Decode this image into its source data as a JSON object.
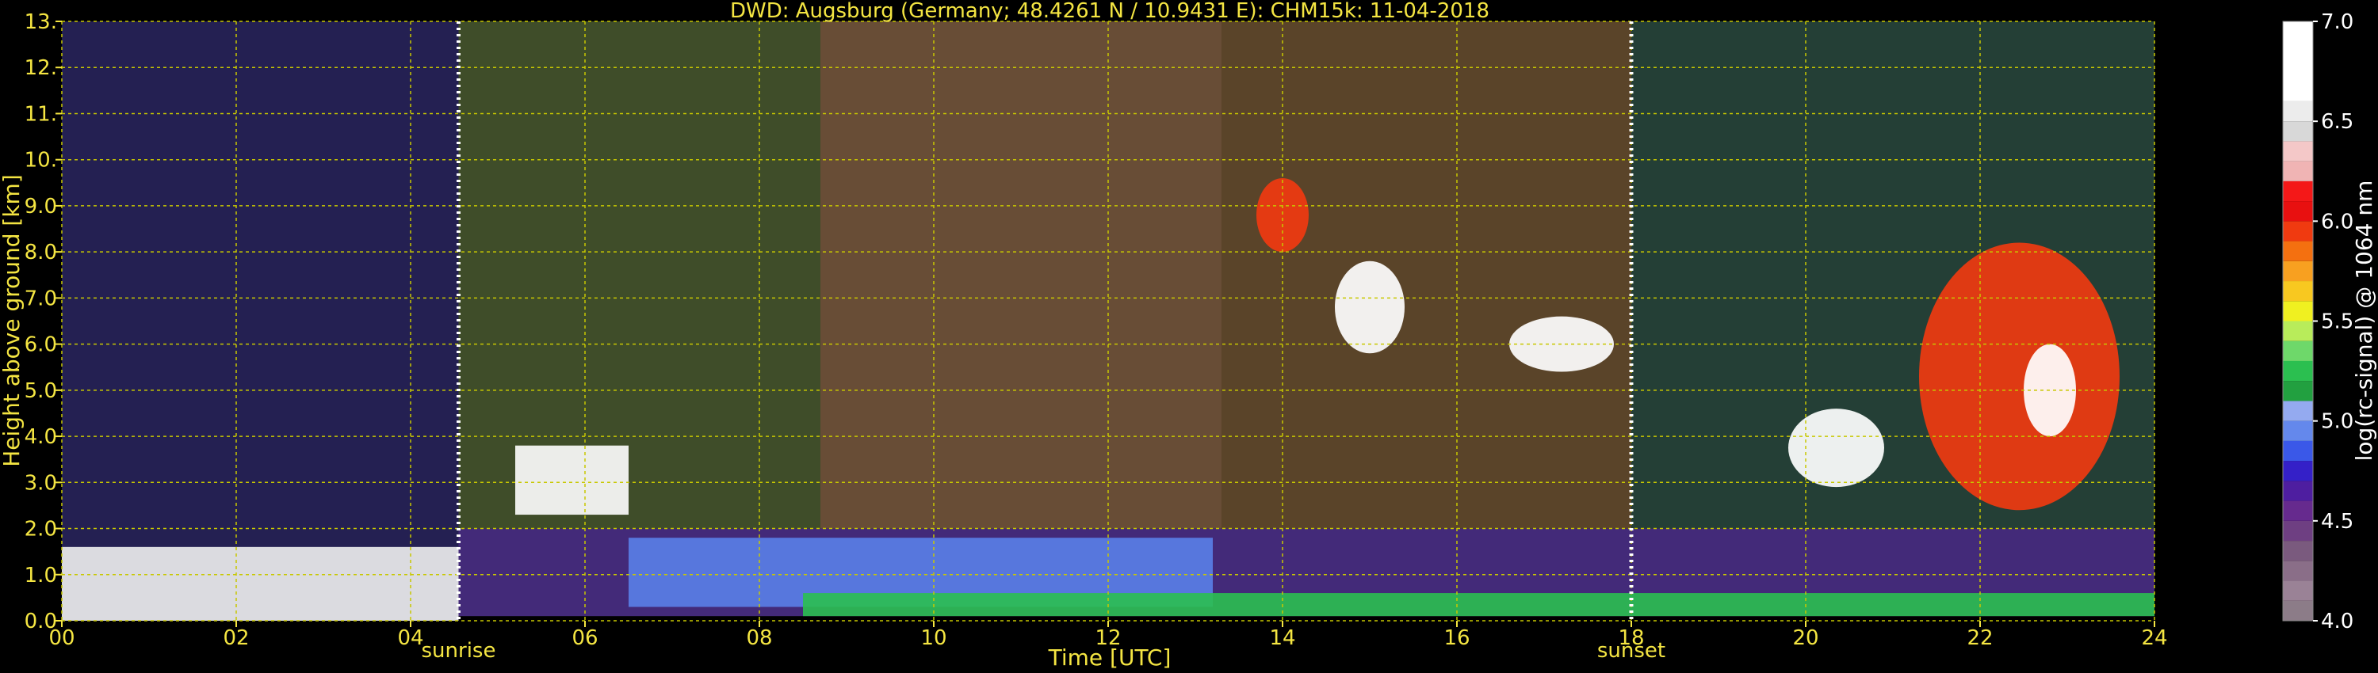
{
  "chart_data": {
    "type": "heatmap",
    "title": "DWD: Augsburg (Germany; 48.4261 N / 10.9431 E):    CHM15k: 11-04-2018",
    "xlabel": "Time [UTC]",
    "ylabel": "Height above ground [km]",
    "xlim": [
      0,
      24
    ],
    "ylim": [
      0,
      13
    ],
    "x_ticks": [
      {
        "value": 0,
        "label": "00"
      },
      {
        "value": 2,
        "label": "02"
      },
      {
        "value": 4,
        "label": "04"
      },
      {
        "value": 6,
        "label": "06"
      },
      {
        "value": 8,
        "label": "08"
      },
      {
        "value": 10,
        "label": "10"
      },
      {
        "value": 12,
        "label": "12"
      },
      {
        "value": 14,
        "label": "14"
      },
      {
        "value": 16,
        "label": "16"
      },
      {
        "value": 18,
        "label": "18"
      },
      {
        "value": 20,
        "label": "20"
      },
      {
        "value": 22,
        "label": "22"
      },
      {
        "value": 24,
        "label": "24"
      }
    ],
    "y_ticks": [
      {
        "value": 0,
        "label": "0.0"
      },
      {
        "value": 1,
        "label": "1.0"
      },
      {
        "value": 2,
        "label": "2.0"
      },
      {
        "value": 3,
        "label": "3.0"
      },
      {
        "value": 4,
        "label": "4.0"
      },
      {
        "value": 5,
        "label": "5.0"
      },
      {
        "value": 6,
        "label": "6.0"
      },
      {
        "value": 7,
        "label": "7.0"
      },
      {
        "value": 8,
        "label": "8.0"
      },
      {
        "value": 9,
        "label": "9.0"
      },
      {
        "value": 10,
        "label": "10."
      },
      {
        "value": 11,
        "label": "11."
      },
      {
        "value": 12,
        "label": "12."
      },
      {
        "value": 13,
        "label": "13."
      }
    ],
    "grid": true,
    "grid_color": "#c8c800",
    "annotations": [
      {
        "x": 4.55,
        "label": "sunrise"
      },
      {
        "x": 18.0,
        "label": "sunset"
      }
    ],
    "colorbar": {
      "label": "log(rc-signal) @ 1064 nm",
      "range": [
        4.0,
        7.0
      ],
      "ticks": [
        {
          "value": 4.0,
          "label": "4.0"
        },
        {
          "value": 4.5,
          "label": "4.5"
        },
        {
          "value": 5.0,
          "label": "5.0"
        },
        {
          "value": 5.5,
          "label": "5.5"
        },
        {
          "value": 6.0,
          "label": "6.0"
        },
        {
          "value": 6.5,
          "label": "6.5"
        },
        {
          "value": 7.0,
          "label": "7.0"
        }
      ],
      "bands": [
        {
          "from": 4.0,
          "to": 4.1,
          "color": "#8c7c88"
        },
        {
          "from": 4.1,
          "to": 4.2,
          "color": "#9a8296"
        },
        {
          "from": 4.2,
          "to": 4.3,
          "color": "#8a6e88"
        },
        {
          "from": 4.3,
          "to": 4.4,
          "color": "#7a5a7e"
        },
        {
          "from": 4.4,
          "to": 4.5,
          "color": "#6e3f82"
        },
        {
          "from": 4.5,
          "to": 4.6,
          "color": "#662a8e"
        },
        {
          "from": 4.6,
          "to": 4.7,
          "color": "#4e1ea0"
        },
        {
          "from": 4.7,
          "to": 4.8,
          "color": "#3420c8"
        },
        {
          "from": 4.8,
          "to": 4.9,
          "color": "#3a58e8"
        },
        {
          "from": 4.9,
          "to": 5.0,
          "color": "#6488ec"
        },
        {
          "from": 5.0,
          "to": 5.1,
          "color": "#94aaf0"
        },
        {
          "from": 5.1,
          "to": 5.2,
          "color": "#22a040"
        },
        {
          "from": 5.2,
          "to": 5.3,
          "color": "#2bbf50"
        },
        {
          "from": 5.3,
          "to": 5.4,
          "color": "#6ed86a"
        },
        {
          "from": 5.4,
          "to": 5.5,
          "color": "#b8ec5a"
        },
        {
          "from": 5.5,
          "to": 5.6,
          "color": "#f0f020"
        },
        {
          "from": 5.6,
          "to": 5.7,
          "color": "#f8c820"
        },
        {
          "from": 5.7,
          "to": 5.8,
          "color": "#f8a020"
        },
        {
          "from": 5.8,
          "to": 5.9,
          "color": "#f47010"
        },
        {
          "from": 5.9,
          "to": 6.0,
          "color": "#f03a10"
        },
        {
          "from": 6.0,
          "to": 6.1,
          "color": "#e81010"
        },
        {
          "from": 6.1,
          "to": 6.2,
          "color": "#f41818"
        },
        {
          "from": 6.2,
          "to": 6.3,
          "color": "#f0b4b4"
        },
        {
          "from": 6.3,
          "to": 6.4,
          "color": "#f4c8c8"
        },
        {
          "from": 6.4,
          "to": 6.5,
          "color": "#d8d8d8"
        },
        {
          "from": 6.5,
          "to": 6.6,
          "color": "#ececec"
        },
        {
          "from": 6.6,
          "to": 7.0,
          "color": "#ffffff"
        }
      ]
    },
    "features": [
      {
        "kind": "background",
        "t0": 0,
        "t1": 4.55,
        "h0": 0,
        "h1": 13,
        "color": "#2a2660"
      },
      {
        "kind": "background",
        "t0": 4.55,
        "t1": 8.7,
        "h0": 2,
        "h1": 13,
        "color": "#4a5a30"
      },
      {
        "kind": "background",
        "t0": 8.7,
        "t1": 13.3,
        "h0": 2,
        "h1": 13,
        "color": "#7a5a40"
      },
      {
        "kind": "background",
        "t0": 13.3,
        "t1": 18,
        "h0": 2,
        "h1": 13,
        "color": "#6a5030"
      },
      {
        "kind": "background",
        "t0": 18,
        "t1": 24,
        "h0": 2,
        "h1": 13,
        "color": "#2a4a40"
      },
      {
        "kind": "layer",
        "t0": 4.55,
        "t1": 24,
        "h0": 0.1,
        "h1": 2.0,
        "color": "#4a2f86"
      },
      {
        "kind": "layer",
        "t0": 6.5,
        "t1": 13.2,
        "h0": 0.3,
        "h1": 1.8,
        "color": "#5a80e8"
      },
      {
        "kind": "layer",
        "t0": 8.5,
        "t1": 24,
        "h0": 0.1,
        "h1": 0.6,
        "color": "#2bbf50"
      },
      {
        "kind": "layer",
        "t0": 0,
        "t1": 4.55,
        "h0": 0,
        "h1": 1.6,
        "color": "#f0f0f0"
      },
      {
        "kind": "layer",
        "t0": 5.2,
        "t1": 6.5,
        "h0": 2.3,
        "h1": 3.8,
        "color": "#ffffff"
      },
      {
        "kind": "cloud",
        "t0": 14.6,
        "t1": 15.4,
        "h0": 5.8,
        "h1": 7.8,
        "color": "#ffffff"
      },
      {
        "kind": "cloud",
        "t0": 16.6,
        "t1": 17.8,
        "h0": 5.4,
        "h1": 6.6,
        "color": "#ffffff"
      },
      {
        "kind": "cloud",
        "t0": 19.8,
        "t1": 20.9,
        "h0": 2.9,
        "h1": 4.6,
        "color": "#ffffff"
      },
      {
        "kind": "cloud",
        "t0": 21.3,
        "t1": 23.6,
        "h0": 2.4,
        "h1": 8.2,
        "color": "#f03a10"
      },
      {
        "kind": "cloud",
        "t0": 22.5,
        "t1": 23.1,
        "h0": 4.0,
        "h1": 6.0,
        "color": "#ffffff"
      },
      {
        "kind": "cloud",
        "t0": 13.7,
        "t1": 14.3,
        "h0": 8.0,
        "h1": 9.6,
        "color": "#f03a10"
      }
    ]
  }
}
